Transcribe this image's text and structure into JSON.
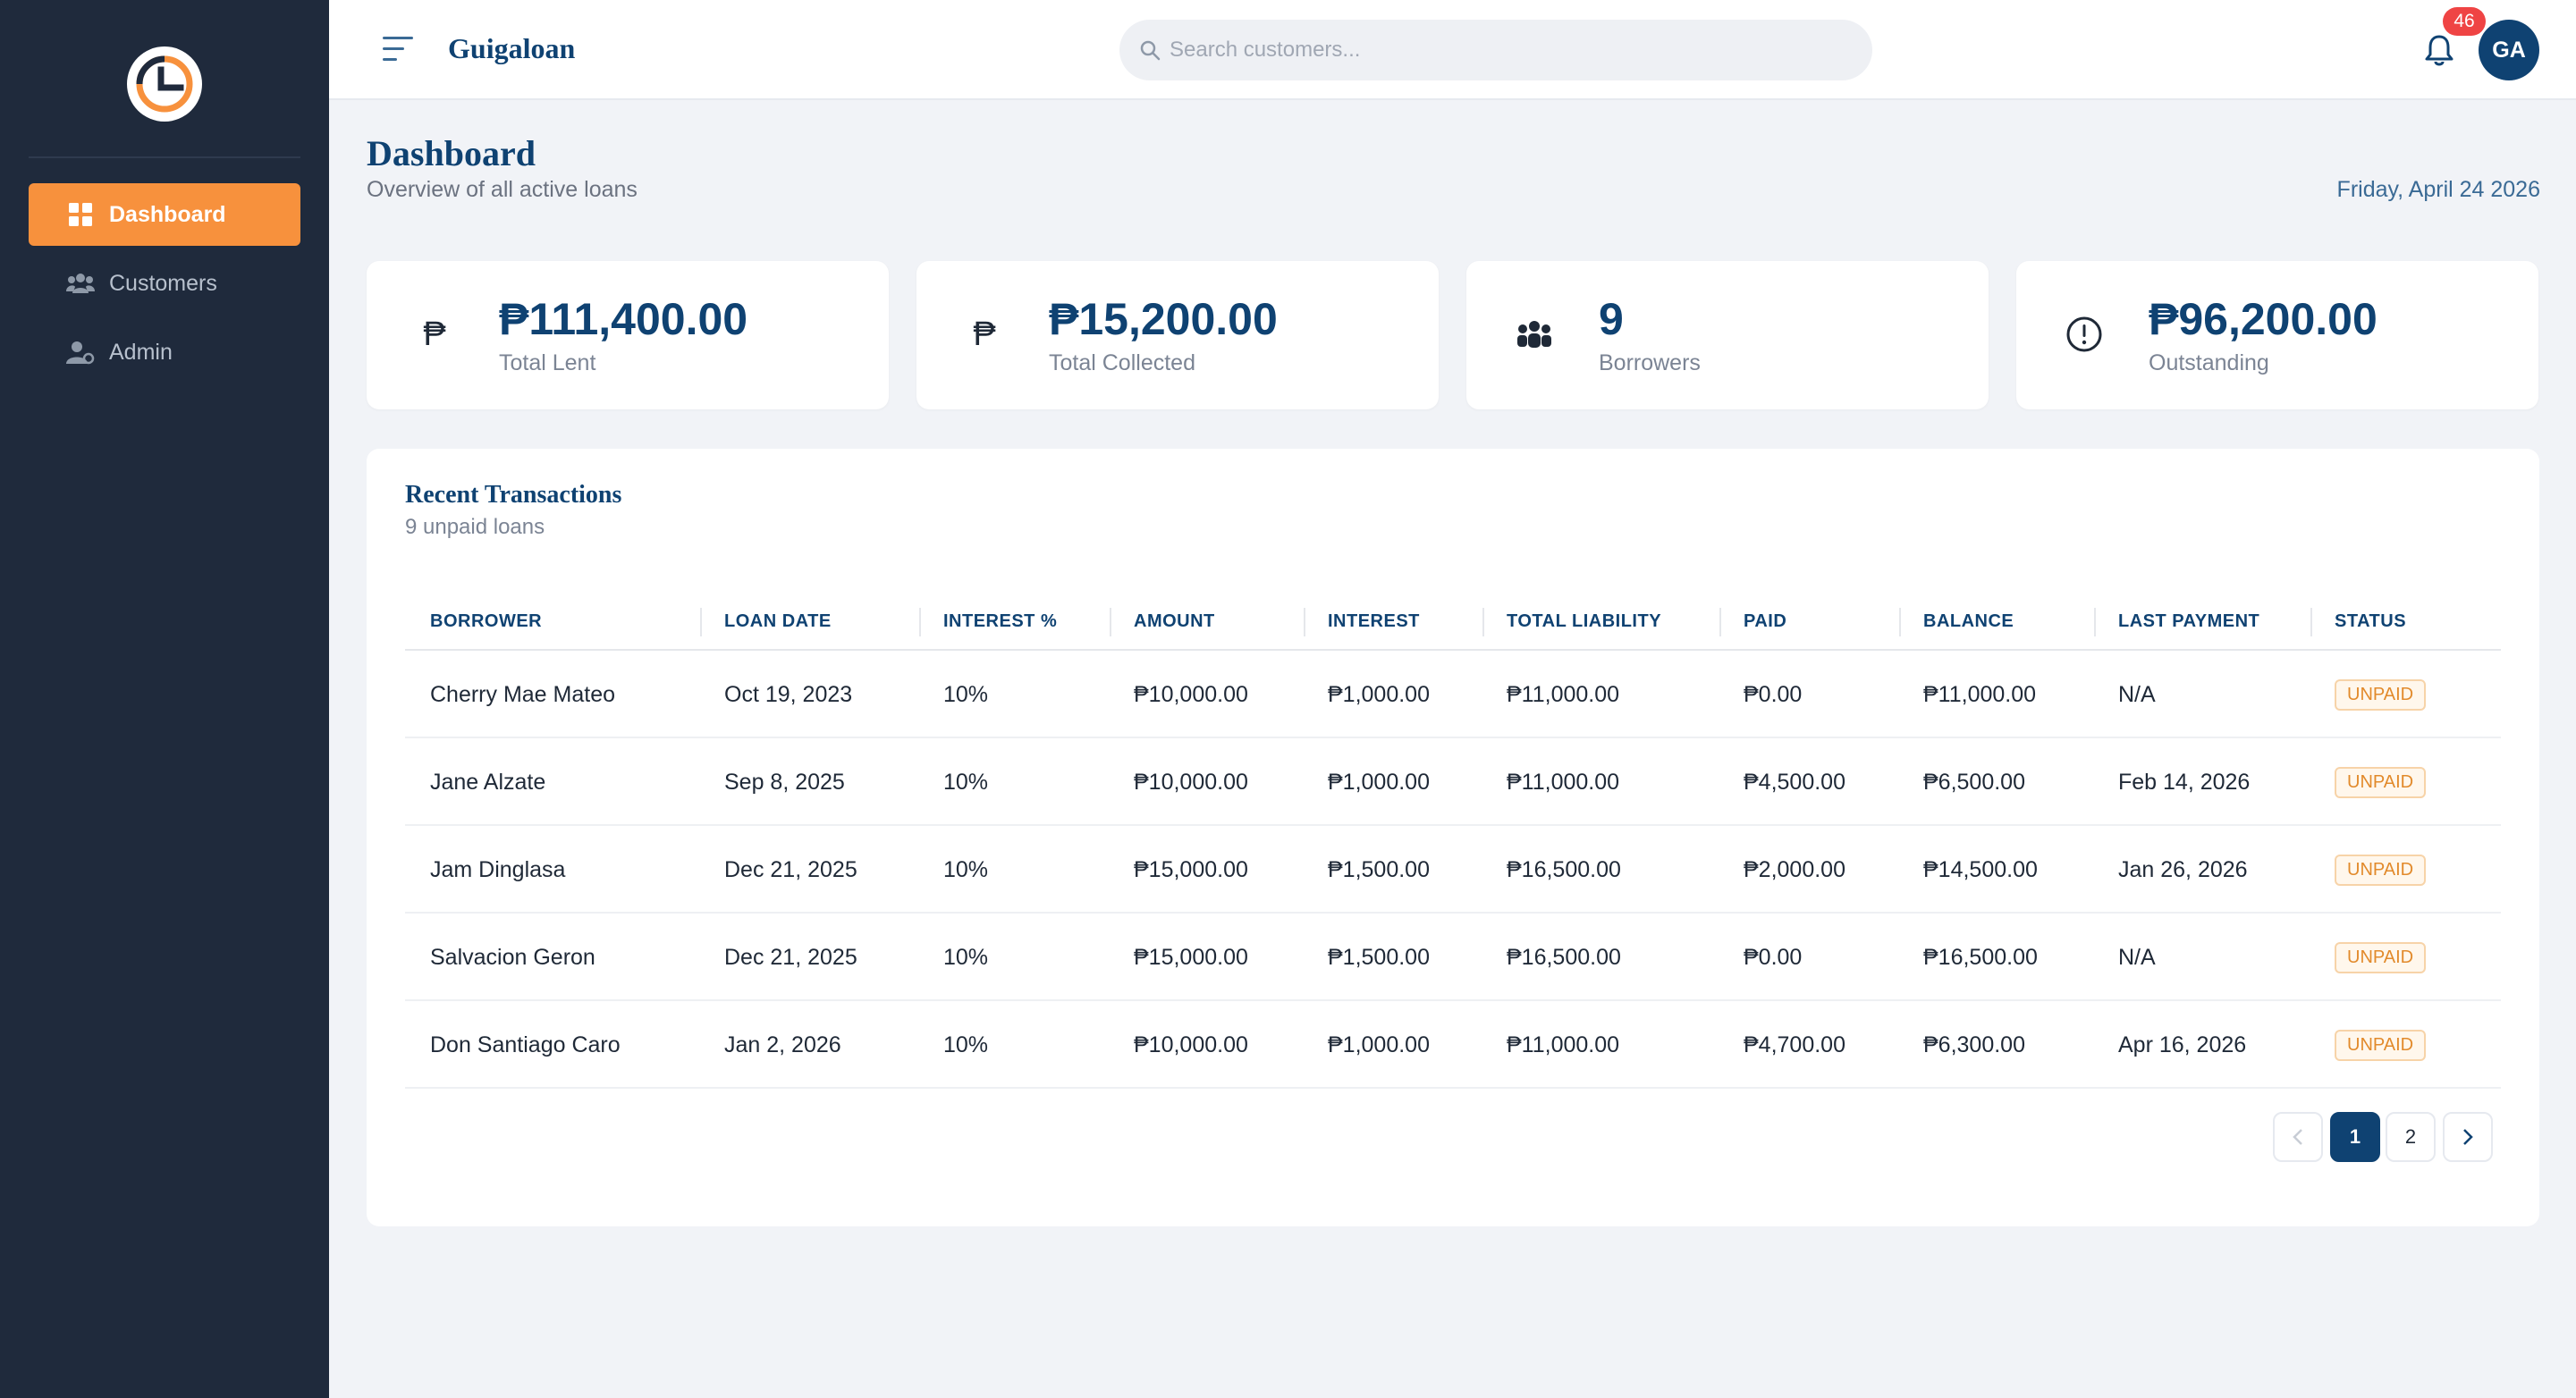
{
  "app": {
    "name": "Guigaloan"
  },
  "sidebar": {
    "items": [
      {
        "label": "Dashboard",
        "icon": "grid-icon",
        "active": true
      },
      {
        "label": "Customers",
        "icon": "users-icon",
        "active": false
      },
      {
        "label": "Admin",
        "icon": "user-cog-icon",
        "active": false
      }
    ]
  },
  "header": {
    "search_placeholder": "Search customers...",
    "notification_count": "46",
    "avatar_initials": "GA"
  },
  "page": {
    "title": "Dashboard",
    "subtitle": "Overview of all active loans",
    "date": "Friday, April 24 2026"
  },
  "stats": [
    {
      "value": "₱111,400.00",
      "label": "Total Lent",
      "icon": "peso-icon"
    },
    {
      "value": "₱15,200.00",
      "label": "Total Collected",
      "icon": "peso-icon"
    },
    {
      "value": "9",
      "label": "Borrowers",
      "icon": "people-icon"
    },
    {
      "value": "₱96,200.00",
      "label": "Outstanding",
      "icon": "alert-circle-icon"
    }
  ],
  "transactions": {
    "title": "Recent Transactions",
    "subtitle": "9 unpaid loans",
    "columns": [
      "BORROWER",
      "LOAN DATE",
      "INTEREST %",
      "AMOUNT",
      "INTEREST",
      "TOTAL LIABILITY",
      "PAID",
      "BALANCE",
      "LAST PAYMENT",
      "STATUS"
    ],
    "rows": [
      [
        "Cherry Mae Mateo",
        "Oct 19, 2023",
        "10%",
        "₱10,000.00",
        "₱1,000.00",
        "₱11,000.00",
        "₱0.00",
        "₱11,000.00",
        "N/A",
        "UNPAID"
      ],
      [
        "Jane Alzate",
        "Sep 8, 2025",
        "10%",
        "₱10,000.00",
        "₱1,000.00",
        "₱11,000.00",
        "₱4,500.00",
        "₱6,500.00",
        "Feb 14, 2026",
        "UNPAID"
      ],
      [
        "Jam Dinglasa",
        "Dec 21, 2025",
        "10%",
        "₱15,000.00",
        "₱1,500.00",
        "₱16,500.00",
        "₱2,000.00",
        "₱14,500.00",
        "Jan 26, 2026",
        "UNPAID"
      ],
      [
        "Salvacion Geron",
        "Dec 21, 2025",
        "10%",
        "₱15,000.00",
        "₱1,500.00",
        "₱16,500.00",
        "₱0.00",
        "₱16,500.00",
        "N/A",
        "UNPAID"
      ],
      [
        "Don Santiago Caro",
        "Jan 2, 2026",
        "10%",
        "₱10,000.00",
        "₱1,000.00",
        "₱11,000.00",
        "₱4,700.00",
        "₱6,300.00",
        "Apr 16, 2026",
        "UNPAID"
      ]
    ]
  },
  "pagination": {
    "pages": [
      "1",
      "2"
    ],
    "current": "1"
  },
  "colors": {
    "sidebar_bg": "#1f2a3c",
    "accent": "#f7913d",
    "primary": "#0f4272",
    "badge": "#ef4444",
    "unpaid": "#e28a2b"
  }
}
